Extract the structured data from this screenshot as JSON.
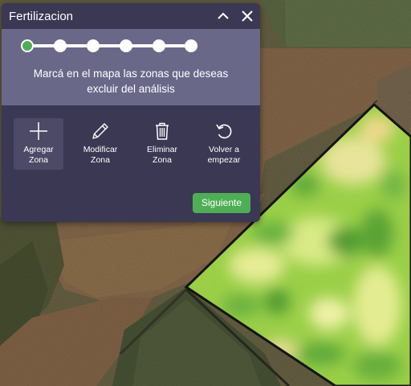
{
  "panel": {
    "title": "Fertilizacion",
    "collapse_icon": "chevron-up-icon",
    "close_icon": "close-icon"
  },
  "steps": {
    "total": 6,
    "current": 1,
    "active_color": "#4fae55"
  },
  "instruction": "Marcá en el mapa las zonas que deseas excluir del análisis",
  "tools": [
    {
      "label": "Agregar Zona",
      "icon": "plus-icon",
      "selected": true
    },
    {
      "label": "Modificar Zona",
      "icon": "pencil-icon",
      "selected": false
    },
    {
      "label": "Eliminar Zona",
      "icon": "trash-icon",
      "selected": false
    },
    {
      "label": "Volver a empezar",
      "icon": "undo-icon",
      "selected": false
    }
  ],
  "next_button": "Siguiente",
  "colors": {
    "panel_dark": "#3a3853",
    "panel_light": "#6a6889",
    "accent_green": "#4fae55"
  }
}
